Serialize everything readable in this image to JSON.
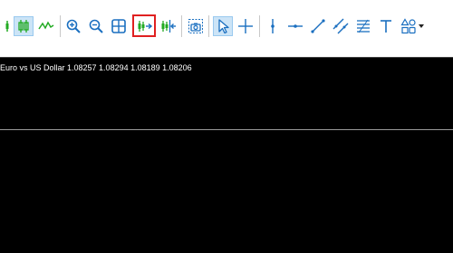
{
  "toolbar": {
    "buttons": [
      {
        "name": "candlesticks-icon",
        "accent": "#22aa22"
      },
      {
        "name": "bar-chart-icon",
        "accent": "#22aa22",
        "pressed": true
      },
      {
        "name": "line-chart-icon",
        "accent": "#22aa22"
      },
      {
        "name": "zoom-in-icon",
        "accent": "#1a6fc0"
      },
      {
        "name": "zoom-out-icon",
        "accent": "#1a6fc0"
      },
      {
        "name": "tile-windows-icon",
        "accent": "#1a6fc0"
      },
      {
        "name": "auto-scroll-icon",
        "accent": "#22aa22",
        "highlighted": true
      },
      {
        "name": "chart-shift-icon",
        "accent": "#22aa22"
      },
      {
        "name": "screenshot-icon",
        "accent": "#1a6fc0"
      },
      {
        "name": "cursor-icon",
        "accent": "#1a6fc0",
        "pressed": true
      },
      {
        "name": "crosshair-icon",
        "accent": "#1a6fc0"
      },
      {
        "name": "vertical-line-icon",
        "accent": "#1a6fc0"
      },
      {
        "name": "horizontal-line-icon",
        "accent": "#1a6fc0"
      },
      {
        "name": "trendline-icon",
        "accent": "#1a6fc0"
      },
      {
        "name": "equidistant-channel-icon",
        "accent": "#1a6fc0"
      },
      {
        "name": "fibonacci-icon",
        "accent": "#1a6fc0"
      },
      {
        "name": "text-icon",
        "accent": "#1a6fc0"
      },
      {
        "name": "shapes-icon",
        "accent": "#1a6fc0"
      },
      {
        "name": "dropdown-arrow-icon",
        "accent": "#222222"
      }
    ]
  },
  "chart": {
    "symbol_info": "Euro vs US Dollar  1.08257 1.08294 1.08189 1.08206",
    "background": "#000000",
    "text_color": "#ffffff"
  }
}
